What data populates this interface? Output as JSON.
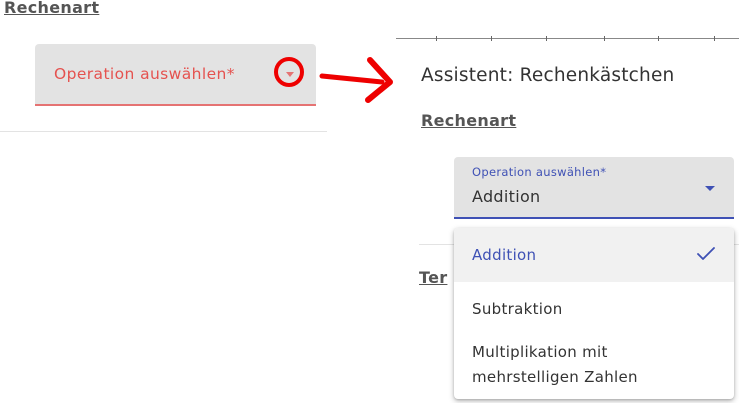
{
  "left_panel": {
    "section_title": "Rechenart",
    "select_placeholder": "Operation auswählen*"
  },
  "right_panel": {
    "assistant_title": "Assistent: Rechenkästchen",
    "section_title": "Rechenart",
    "select_label": "Operation auswählen*",
    "select_value": "Addition",
    "next_section_partial": "Ter",
    "options": [
      {
        "label": "Addition",
        "selected": true
      },
      {
        "label": "Subtraktion",
        "selected": false
      },
      {
        "label": "Multiplikation mit mehrstelligen Zahlen",
        "selected": false
      }
    ]
  },
  "icons": {
    "left_caret": "caret-down-icon",
    "highlight": "red-circle-highlight",
    "arrow": "red-arrow-right",
    "right_caret": "caret-down-icon",
    "check": "check-icon"
  },
  "colors": {
    "error": "#e5524f",
    "highlight_red": "#ee0000",
    "primary": "#3f51b5",
    "field_bg": "#e3e3e3",
    "selected_option_bg": "#f1f1f1"
  }
}
